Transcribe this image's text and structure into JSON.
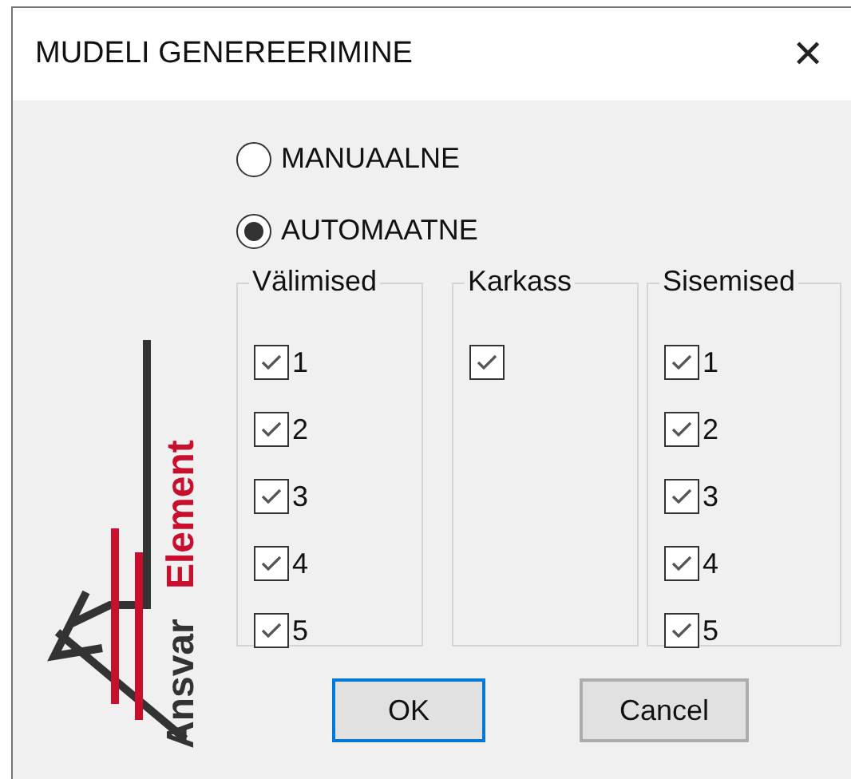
{
  "window": {
    "title": "MUDELI GENEREERIMINE",
    "close": "✕"
  },
  "logo": {
    "brand": "Ansvar",
    "product": "Element"
  },
  "modes": [
    {
      "label": "MANUAALNE",
      "selected": false
    },
    {
      "label": "AUTOMAATNE",
      "selected": true
    }
  ],
  "groups": [
    {
      "title": "Välimised",
      "items": [
        {
          "label": "1",
          "checked": true
        },
        {
          "label": "2",
          "checked": true
        },
        {
          "label": "3",
          "checked": true
        },
        {
          "label": "4",
          "checked": true
        },
        {
          "label": "5",
          "checked": true
        }
      ]
    },
    {
      "title": "Karkass",
      "items": [
        {
          "checked": true
        }
      ]
    },
    {
      "title": "Sisemised",
      "items": [
        {
          "label": "1",
          "checked": true
        },
        {
          "label": "2",
          "checked": true
        },
        {
          "label": "3",
          "checked": true
        },
        {
          "label": "4",
          "checked": true
        },
        {
          "label": "5",
          "checked": true
        }
      ]
    }
  ],
  "buttons": [
    {
      "label": "OK",
      "default": true
    },
    {
      "label": "Cancel",
      "default": false
    }
  ]
}
